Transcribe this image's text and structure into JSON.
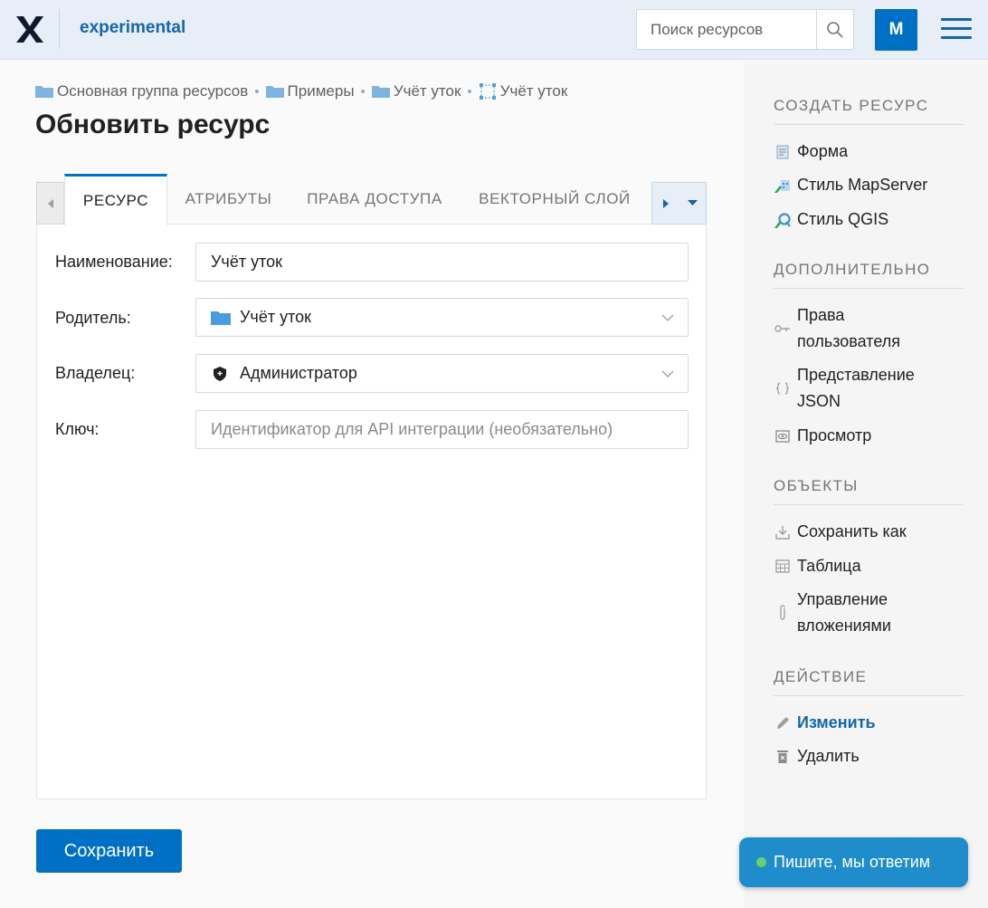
{
  "header": {
    "app_name": "experimental",
    "search_placeholder": "Поиск ресурсов",
    "avatar_letter": "M"
  },
  "breadcrumb": [
    {
      "label": "Основная группа ресурсов",
      "icon": "folder-icon"
    },
    {
      "label": "Примеры",
      "icon": "folder-icon"
    },
    {
      "label": "Учёт уток",
      "icon": "folder-icon"
    },
    {
      "label": "Учёт уток",
      "icon": "vector-layer-icon"
    }
  ],
  "page_title": "Обновить ресурс",
  "tabs": [
    {
      "label": "РЕСУРС",
      "active": true
    },
    {
      "label": "АТРИБУТЫ",
      "active": false
    },
    {
      "label": "ПРАВА ДОСТУПА",
      "active": false
    },
    {
      "label": "ВЕКТОРНЫЙ СЛОЙ",
      "active": false
    }
  ],
  "form": {
    "name": {
      "label": "Наименование:",
      "value": "Учёт уток"
    },
    "parent": {
      "label": "Родитель:",
      "value": "Учёт уток"
    },
    "owner": {
      "label": "Владелец:",
      "value": "Администратор"
    },
    "key": {
      "label": "Ключ:",
      "placeholder": "Идентификатор для API интеграции (необязательно)"
    }
  },
  "save_label": "Сохранить",
  "sidebar": {
    "create_heading": "СОЗДАТЬ РЕСУРС",
    "create_items": [
      {
        "label": "Форма",
        "icon": "form-icon"
      },
      {
        "label": "Стиль MapServer",
        "icon": "mapserver-style-icon"
      },
      {
        "label": "Стиль QGIS",
        "icon": "qgis-style-icon"
      }
    ],
    "extra_heading": "ДОПОЛНИТЕЛЬНО",
    "extra_items": [
      {
        "label_line1": "Права",
        "label_line2": "пользователя",
        "icon": "key-icon"
      },
      {
        "label_line1": "Представление",
        "label_line2": "JSON",
        "icon": "braces-icon"
      },
      {
        "label": "Просмотр",
        "icon": "eye-icon"
      }
    ],
    "objects_heading": "ОБЪЕКТЫ",
    "objects_items": [
      {
        "label": "Сохранить как",
        "icon": "download-icon"
      },
      {
        "label": "Таблица",
        "icon": "table-icon"
      },
      {
        "label_line1": "Управление",
        "label_line2": "вложениями",
        "icon": "paperclip-icon"
      }
    ],
    "action_heading": "ДЕЙСТВИЕ",
    "action_items": [
      {
        "label": "Изменить",
        "icon": "pencil-icon",
        "active": true
      },
      {
        "label": "Удалить",
        "icon": "trash-icon"
      }
    ]
  },
  "chat_label": "Пишите, мы ответим",
  "colors": {
    "accent": "#0070c5",
    "header_bg": "#e7eef7",
    "chat_bg": "#1f8ccb"
  }
}
